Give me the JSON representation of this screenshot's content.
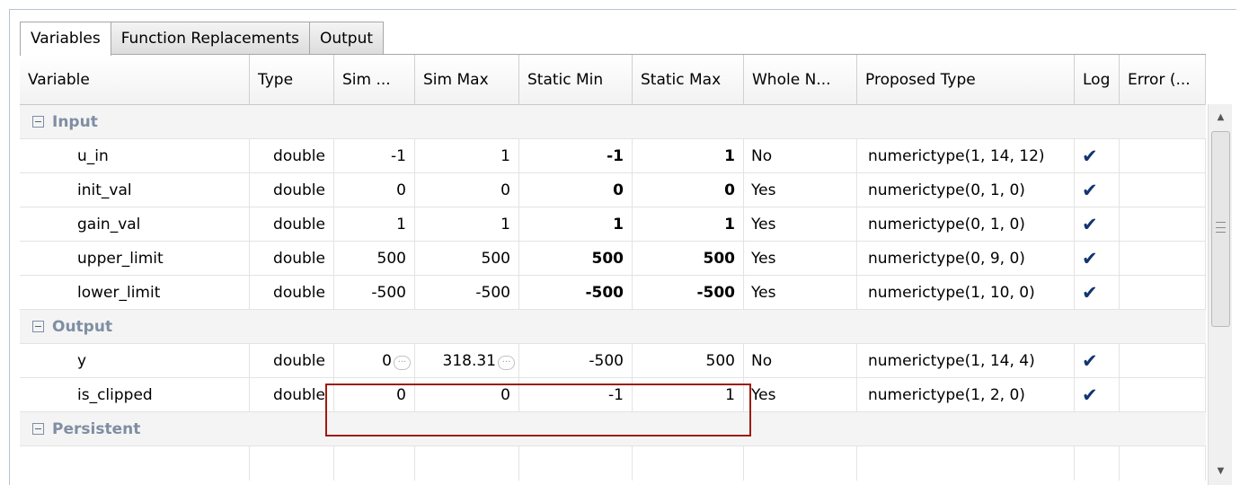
{
  "tabs": [
    "Variables",
    "Function Replacements",
    "Output"
  ],
  "columns": {
    "variable": "Variable",
    "type": "Type",
    "sim_min": "Sim ...",
    "sim_max": "Sim Max",
    "static_min": "Static Min",
    "static_max": "Static Max",
    "whole": "Whole N...",
    "proposed": "Proposed Type",
    "log": "Log",
    "error": "Error (..."
  },
  "groups": {
    "input": {
      "label": "Input",
      "rows": [
        {
          "variable": "u_in",
          "type": "double",
          "sim_min": "-1",
          "sim_max": "1",
          "static_min": "-1",
          "static_max": "1",
          "whole": "No",
          "proposed": "numerictype(1, 14, 12)",
          "log": true
        },
        {
          "variable": "init_val",
          "type": "double",
          "sim_min": "0",
          "sim_max": "0",
          "static_min": "0",
          "static_max": "0",
          "whole": "Yes",
          "proposed": "numerictype(0, 1, 0)",
          "log": true
        },
        {
          "variable": "gain_val",
          "type": "double",
          "sim_min": "1",
          "sim_max": "1",
          "static_min": "1",
          "static_max": "1",
          "whole": "Yes",
          "proposed": "numerictype(0, 1, 0)",
          "log": true
        },
        {
          "variable": "upper_limit",
          "type": "double",
          "sim_min": "500",
          "sim_max": "500",
          "static_min": "500",
          "static_max": "500",
          "whole": "Yes",
          "proposed": "numerictype(0, 9, 0)",
          "log": true
        },
        {
          "variable": "lower_limit",
          "type": "double",
          "sim_min": "-500",
          "sim_max": "-500",
          "static_min": "-500",
          "static_max": "-500",
          "whole": "Yes",
          "proposed": "numerictype(1, 10, 0)",
          "log": true
        }
      ]
    },
    "output": {
      "label": "Output",
      "rows": [
        {
          "variable": "y",
          "type": "double",
          "sim_min": "0",
          "sim_max": "318.31",
          "static_min": "-500",
          "static_max": "500",
          "whole": "No",
          "proposed": "numerictype(1, 14, 4)",
          "log": true
        },
        {
          "variable": "is_clipped",
          "type": "double",
          "sim_min": "0",
          "sim_max": "0",
          "static_min": "-1",
          "static_max": "1",
          "whole": "Yes",
          "proposed": "numerictype(1, 2, 0)",
          "log": true
        }
      ]
    },
    "persistent": {
      "label": "Persistent"
    }
  },
  "icons": {
    "check": "check-icon",
    "more": "more-icon",
    "collapse": "minus-icon"
  },
  "colors": {
    "group_label": "#7f8ea3",
    "check": "#10356f",
    "highlight": "#9d1c0c"
  }
}
